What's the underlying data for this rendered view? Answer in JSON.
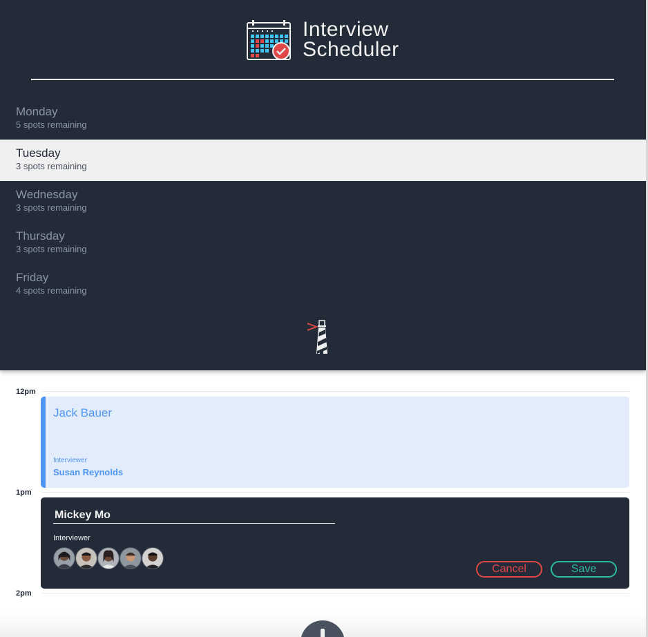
{
  "app": {
    "title_line1": "Interview",
    "title_line2": "Scheduler"
  },
  "days": [
    {
      "name": "Monday",
      "spots": "5 spots remaining"
    },
    {
      "name": "Tuesday",
      "spots": "3 spots remaining",
      "selected": true
    },
    {
      "name": "Wednesday",
      "spots": "3 spots remaining"
    },
    {
      "name": "Thursday",
      "spots": "3 spots remaining"
    },
    {
      "name": "Friday",
      "spots": "4 spots remaining"
    }
  ],
  "schedule": {
    "times": [
      "12pm",
      "1pm",
      "2pm"
    ],
    "appointment": {
      "student": "Jack Bauer",
      "interviewer_label": "Interviewer",
      "interviewer_name": "Susan Reynolds"
    },
    "form": {
      "student_value": "Mickey Mo",
      "interviewer_label": "Interviewer",
      "cancel_label": "Cancel",
      "save_label": "Save",
      "avatars": [
        "interviewer-1",
        "interviewer-2",
        "interviewer-3",
        "interviewer-4",
        "interviewer-5"
      ]
    }
  },
  "icons": {
    "logo": "calendar-check-icon",
    "footer": "lighthouse-icon",
    "add": "plus-icon"
  },
  "colors": {
    "sidebar_bg": "#222b37",
    "accent_blue": "#4f96f0",
    "cancel_red": "#e04848",
    "save_green": "#2dbd9a"
  }
}
